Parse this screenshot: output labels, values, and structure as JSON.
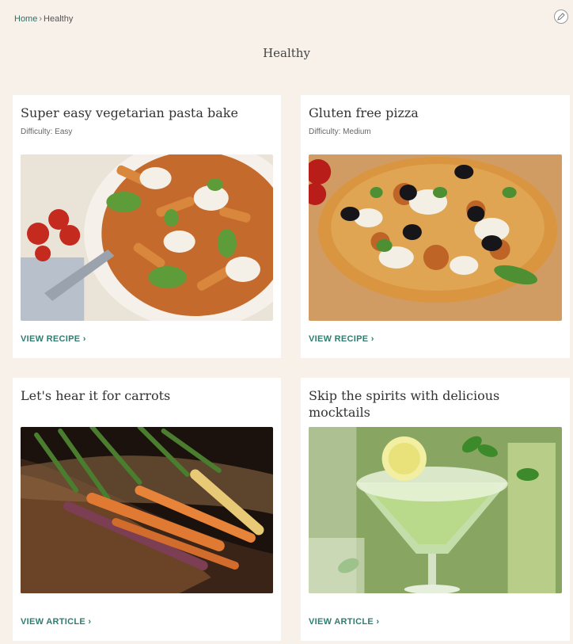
{
  "breadcrumb": {
    "home": "Home",
    "separator": "›",
    "current": "Healthy"
  },
  "page": {
    "title": "Healthy"
  },
  "cards": [
    {
      "title": "Super easy vegetarian pasta bake",
      "difficulty_label": "Difficulty:",
      "difficulty": "Easy",
      "cta": "VIEW RECIPE ›",
      "image": "pasta-bake-photo"
    },
    {
      "title": "Gluten free pizza",
      "difficulty_label": "Difficulty:",
      "difficulty": "Medium",
      "cta": "VIEW RECIPE ›",
      "image": "pizza-photo"
    },
    {
      "title": "Let's hear it for carrots",
      "cta": "VIEW ARTICLE ›",
      "image": "carrots-photo"
    },
    {
      "title": "Skip the spirits with delicious mocktails",
      "cta": "VIEW ARTICLE ›",
      "image": "mocktail-photo"
    }
  ],
  "icons": {
    "edit": "pencil-icon"
  },
  "colors": {
    "background": "#f8f1ea",
    "accent": "#2f7d71"
  }
}
